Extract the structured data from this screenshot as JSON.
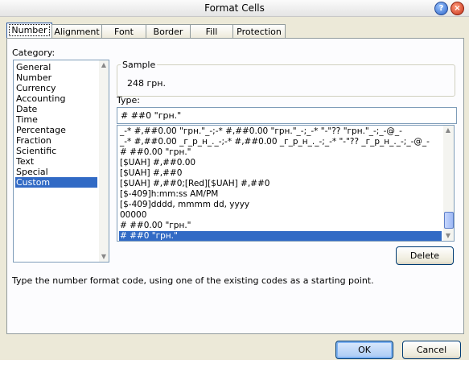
{
  "window": {
    "title": "Format Cells",
    "help_icon": "?",
    "close_icon": "×"
  },
  "tabs": [
    "Number",
    "Alignment",
    "Font",
    "Border",
    "Fill",
    "Protection"
  ],
  "category": {
    "label": "Category:",
    "items": [
      "General",
      "Number",
      "Currency",
      "Accounting",
      "Date",
      "Time",
      "Percentage",
      "Fraction",
      "Scientific",
      "Text",
      "Special",
      "Custom"
    ],
    "selected": "Custom"
  },
  "sample": {
    "label": "Sample",
    "value": "248 грн."
  },
  "type": {
    "label": "Type:",
    "value": "# ##0 \"грн.\"",
    "formats": [
      "_-* #,##0.00 \"грн.\"_-;-* #,##0.00 \"грн.\"_-;_-* \"-\"?? \"грн.\"_-;_-@_-",
      "_-* #,##0.00 _г_р_н_._-;-* #,##0.00 _г_р_н_._-;_-* \"-\"?? _г_р_н_._-;_-@_-",
      "# ##0.00 \"грн.\"",
      "[$UAH] #,##0.00",
      "[$UAH] #,##0",
      "[$UAH] #,##0;[Red][$UAH] #,##0",
      "[$-409]h:mm:ss AM/PM",
      "[$-409]dddd, mmmm dd, yyyy",
      "00000",
      "# ##0.00 \"грн.\"",
      "# ##0 \"грн.\""
    ],
    "selected_index": 10
  },
  "delete_label": "Delete",
  "description": "Type the number format code, using one of the existing codes as a starting point.",
  "ok_label": "OK",
  "cancel_label": "Cancel"
}
